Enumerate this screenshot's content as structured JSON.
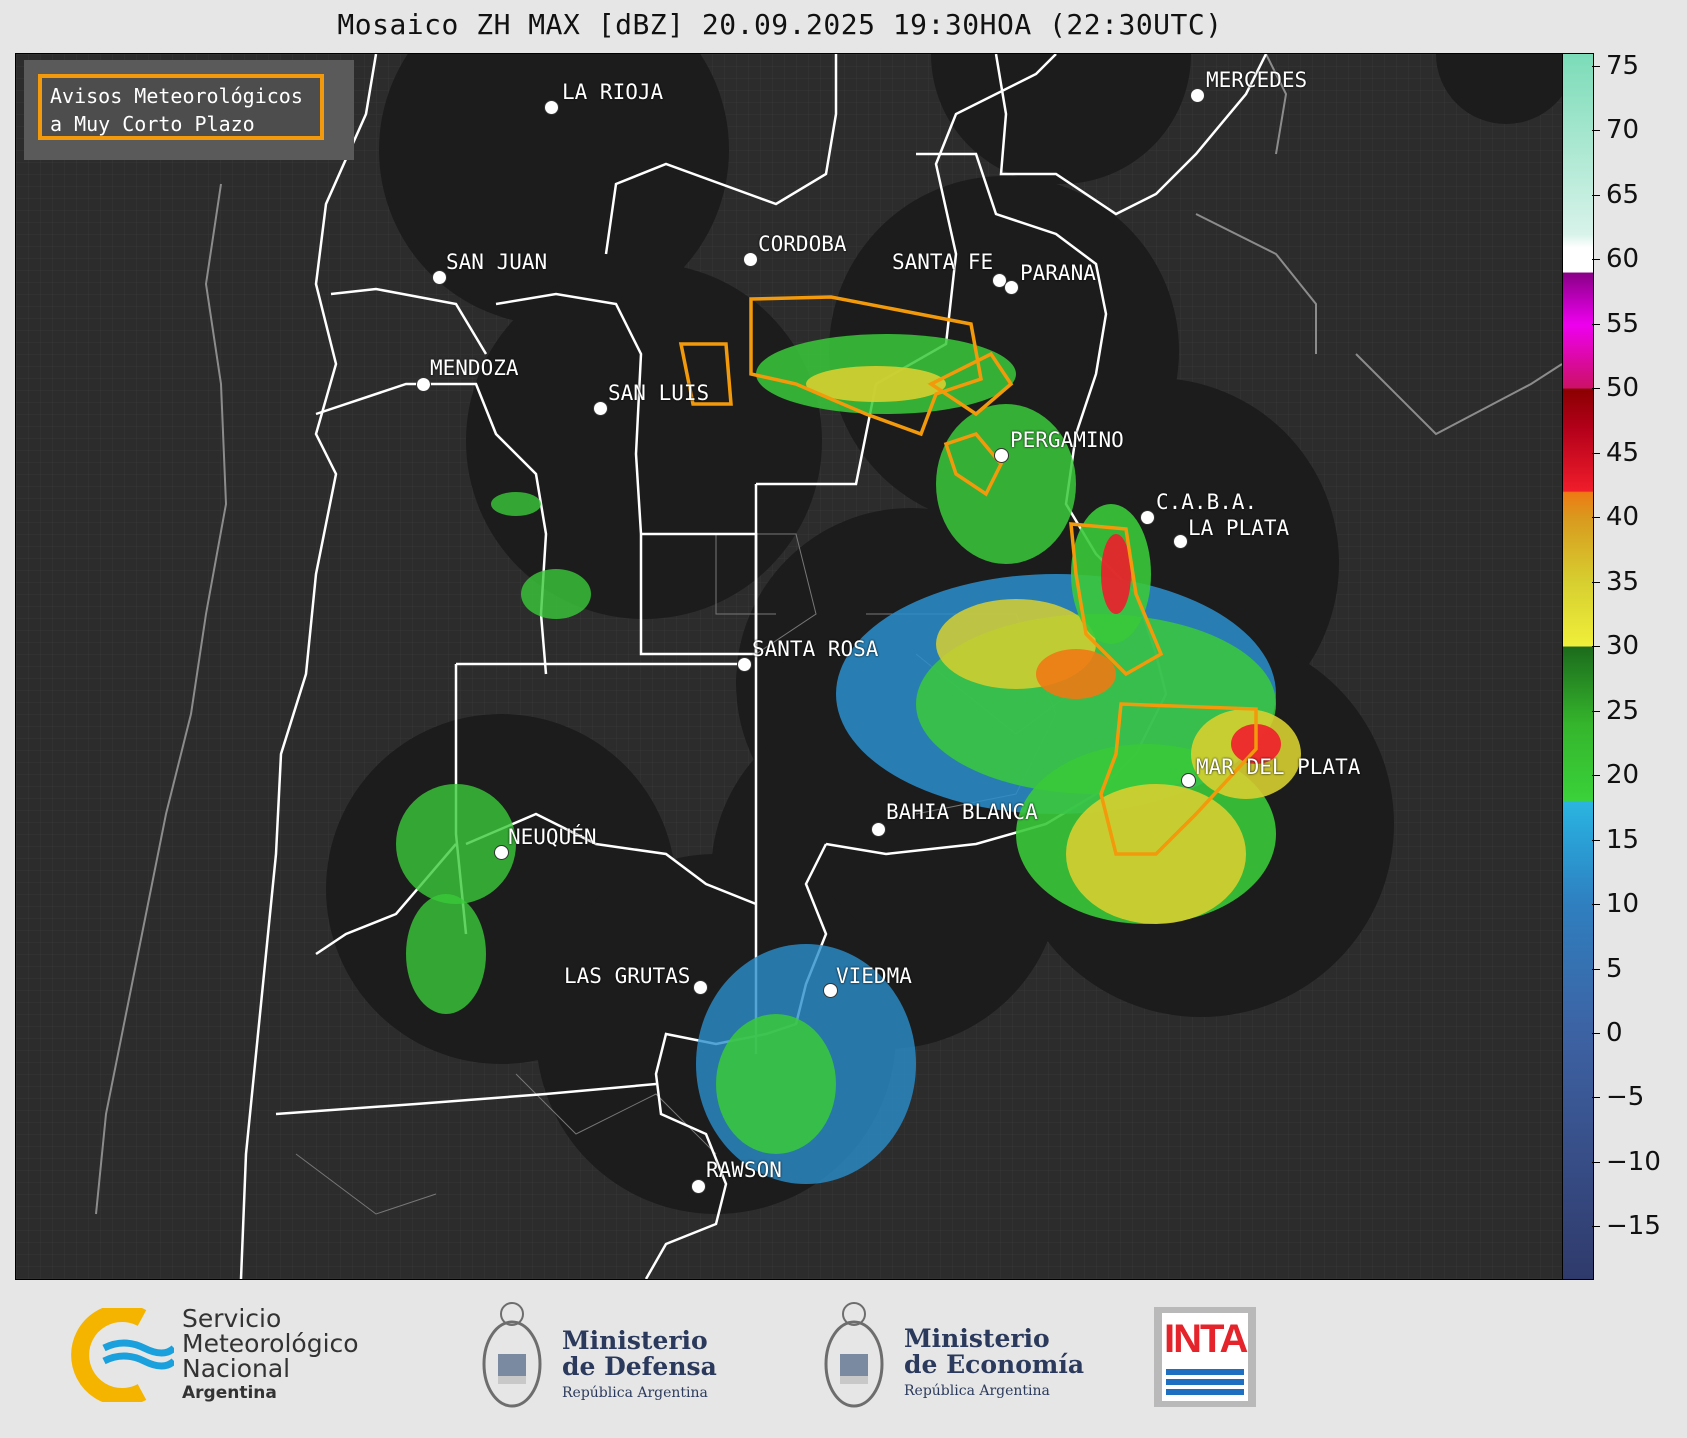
{
  "title": "Mosaico ZH MAX [dBZ] 20.09.2025 19:30HOA (22:30UTC)",
  "legend_box": "Avisos Meteorológicos\na Muy Corto Plazo",
  "warning_color": "#f29a0b",
  "cities": [
    {
      "name": "LA RIOJA"
    },
    {
      "name": "MERCEDES"
    },
    {
      "name": "CORDOBA"
    },
    {
      "name": "SAN JUAN"
    },
    {
      "name": "SANTA FE"
    },
    {
      "name": "PARANA"
    },
    {
      "name": "MENDOZA"
    },
    {
      "name": "SAN LUIS"
    },
    {
      "name": "PERGAMINO"
    },
    {
      "name": "C.A.B.A."
    },
    {
      "name": "LA PLATA"
    },
    {
      "name": "SANTA ROSA"
    },
    {
      "name": "MAR DEL PLATA"
    },
    {
      "name": "BAHIA BLANCA"
    },
    {
      "name": "NEUQUÉN"
    },
    {
      "name": "LAS GRUTAS"
    },
    {
      "name": "VIEDMA"
    },
    {
      "name": "RAWSON"
    }
  ],
  "colorbar": {
    "unit": "dBZ",
    "min": -19,
    "max": 76,
    "ticks": [
      75,
      70,
      65,
      60,
      55,
      50,
      45,
      40,
      35,
      30,
      25,
      20,
      15,
      10,
      5,
      0,
      -5,
      -10,
      -15
    ],
    "tick_labels": [
      "75",
      "70",
      "65",
      "60",
      "55",
      "50",
      "45",
      "40",
      "35",
      "30",
      "25",
      "20",
      "15",
      "10",
      "5",
      "0",
      "−5",
      "−10",
      "−15"
    ],
    "stops": [
      {
        "v": -19,
        "c": "#2f3a6b"
      },
      {
        "v": -10,
        "c": "#374d86"
      },
      {
        "v": 0,
        "c": "#3d62a3"
      },
      {
        "v": 10,
        "c": "#2f7fbf"
      },
      {
        "v": 15,
        "c": "#2aa0d6"
      },
      {
        "v": 18,
        "c": "#2bb5e0"
      },
      {
        "v": 18.1,
        "c": "#3ad23a"
      },
      {
        "v": 24,
        "c": "#35b52c"
      },
      {
        "v": 30,
        "c": "#1c6b1c"
      },
      {
        "v": 30.1,
        "c": "#f0ef3a"
      },
      {
        "v": 35,
        "c": "#d7cf30"
      },
      {
        "v": 40,
        "c": "#d99a1e"
      },
      {
        "v": 42,
        "c": "#ee7a14"
      },
      {
        "v": 42.1,
        "c": "#f01d2b"
      },
      {
        "v": 47,
        "c": "#b3001a"
      },
      {
        "v": 50,
        "c": "#8a0000"
      },
      {
        "v": 50.1,
        "c": "#cc1166"
      },
      {
        "v": 55,
        "c": "#ee00ee"
      },
      {
        "v": 59,
        "c": "#8a0088"
      },
      {
        "v": 59.1,
        "c": "#ffffff"
      },
      {
        "v": 61,
        "c": "#ffffff"
      },
      {
        "v": 62,
        "c": "#d8f3ea"
      },
      {
        "v": 76,
        "c": "#7bdcb8"
      }
    ]
  },
  "logos": {
    "smn": {
      "line1": "Servicio",
      "line2": "Meteorológico",
      "line3": "Nacional",
      "line4": "Argentina"
    },
    "defensa": {
      "line1": "Ministerio",
      "line2": "de Defensa",
      "line3": "República Argentina"
    },
    "economia": {
      "line1": "Ministerio",
      "line2": "de Economía",
      "line3": "República Argentina"
    },
    "inta": "INTA"
  }
}
